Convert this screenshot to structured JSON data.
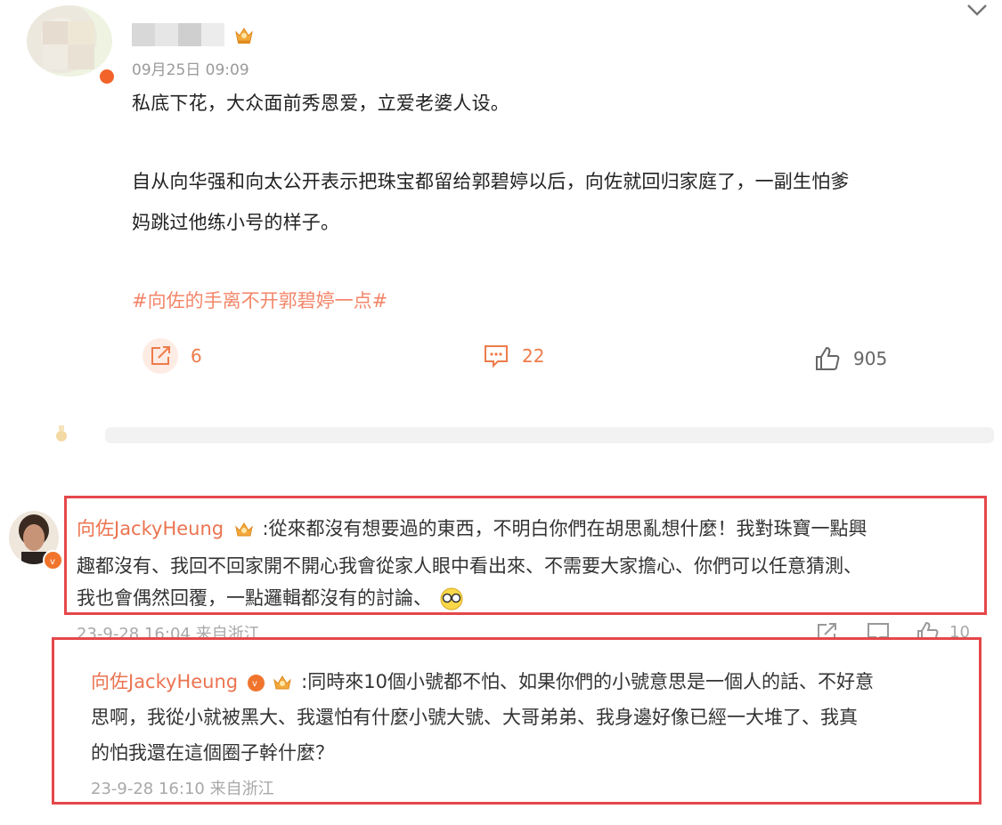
{
  "post": {
    "time": "09月25日 09:09",
    "paragraph1": "私底下花，大众面前秀恩爱，立爱老婆人设。",
    "paragraph2_line1": "自从向华强和向太公开表示把珠宝都留给郭碧婷以后，向佐就回归家庭了，一副生怕爹",
    "paragraph2_line2": "妈跳过他练小号的样子。",
    "hashtag": "#向佐的手离不开郭碧婷一点#",
    "actions": {
      "share_count": "6",
      "comment_count": "22",
      "like_count": "905"
    }
  },
  "comments": [
    {
      "author": "向佐JackyHeung",
      "text_line1": ":從來都沒有想要過的東西，不明白你們在胡思亂想什麼！我對珠寶一點興",
      "text_line2": "趣都沒有、我回不回家開不開心我會從家人眼中看出來、不需要大家擔心、你們可以任意猜測、",
      "text_line3": "我也會偶然回覆，一點邏輯都沒有的討論、",
      "meta": "23-9-28 16:04 来自浙江",
      "like_count": "10"
    },
    {
      "author": "向佐JackyHeung",
      "text_line1": ":同時來10個小號都不怕、如果你們的小號意思是一個人的話、不好意",
      "text_line2": "思啊，我從小就被黑大、我還怕有什麼小號大號、大哥弟弟、我身邊好像已經一大堆了、我真",
      "text_line3": "的怕我還在這個圈子幹什麼？",
      "meta": "23-9-28 16:10 来自浙江"
    }
  ],
  "colors": {
    "accent_orange": "#eb7350",
    "hashtag": "#f3866a",
    "highlight_border": "#e5474b",
    "vip_badge": "#f0742c"
  },
  "icons": [
    "crown-icon",
    "chevron-down-icon",
    "share-icon",
    "comment-icon",
    "like-icon",
    "verified-badge-icon",
    "emoji-icon"
  ]
}
